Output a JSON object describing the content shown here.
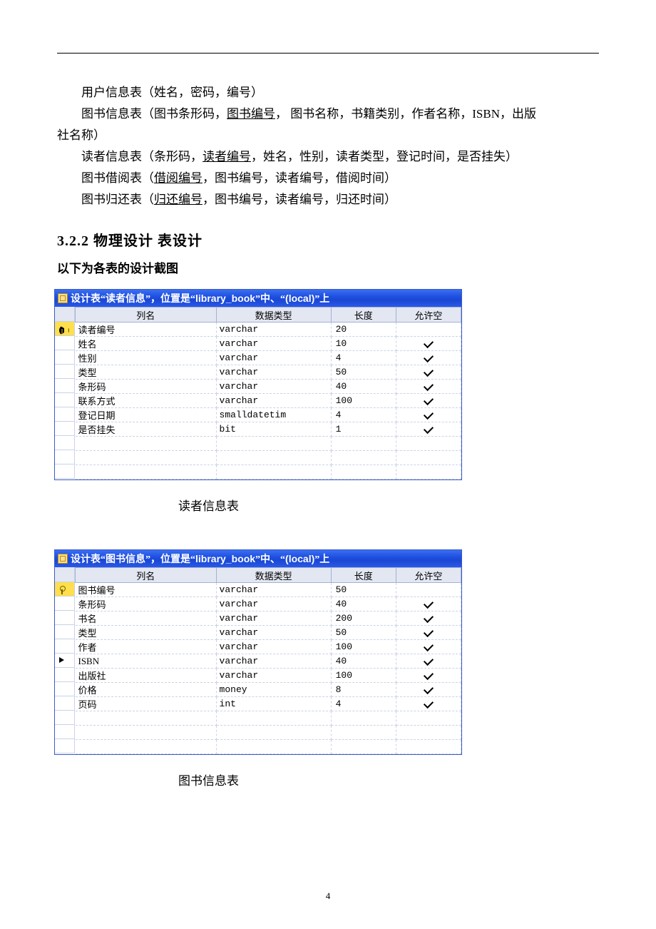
{
  "text": {
    "line1": "用户信息表（姓名，密码，编号）",
    "line2a": "图书信息表（图书条形码，",
    "line2u": "图书编号",
    "line2b": "， 图书名称，书籍类别，作者名称，ISBN，出版",
    "line2c": "社名称）",
    "line3a": "读者信息表（条形码，",
    "line3u": "读者编号",
    "line3b": "，姓名，性别，读者类型，登记时间，是否挂失）",
    "line4a": "图书借阅表（",
    "line4u": "借阅编号",
    "line4b": "，图书编号，读者编号，借阅时间）",
    "line5a": "图书归还表（",
    "line5u": "归还编号",
    "line5b": "，图书编号，读者编号，归还时间）"
  },
  "heading": "3.2.2 物理设计 表设计",
  "subtext": "以下为各表的设计截图",
  "tables": [
    {
      "title_parts": [
        "设计表",
        "“",
        "读者信息",
        "”",
        "，位置是",
        "“",
        "library_book",
        "”",
        "中、",
        "“",
        "(local)",
        "”",
        "上"
      ],
      "caption": "读者信息表",
      "headers": [
        "列名",
        "数据类型",
        "长度",
        "允许空"
      ],
      "rows": [
        {
          "name": "读者编号",
          "type": "varchar",
          "len": "20",
          "null": false,
          "pk": true,
          "cur": true
        },
        {
          "name": "姓名",
          "type": "varchar",
          "len": "10",
          "null": true,
          "pk": false,
          "cur": false
        },
        {
          "name": "性别",
          "type": "varchar",
          "len": "4",
          "null": true,
          "pk": false,
          "cur": false
        },
        {
          "name": "类型",
          "type": "varchar",
          "len": "50",
          "null": true,
          "pk": false,
          "cur": false
        },
        {
          "name": "条形码",
          "type": "varchar",
          "len": "40",
          "null": true,
          "pk": false,
          "cur": false
        },
        {
          "name": "联系方式",
          "type": "varchar",
          "len": "100",
          "null": true,
          "pk": false,
          "cur": false
        },
        {
          "name": "登记日期",
          "type": "smalldatetim",
          "len": "4",
          "null": true,
          "pk": false,
          "cur": false
        },
        {
          "name": "是否挂失",
          "type": "bit",
          "len": "1",
          "null": true,
          "pk": false,
          "cur": false
        }
      ],
      "blank_rows": 3
    },
    {
      "title_parts": [
        "设计表",
        "“",
        "图书信息",
        "”",
        "，位置是",
        "“",
        "library_book",
        "”",
        "中、",
        "“",
        "(local)",
        "”",
        "上"
      ],
      "caption": "图书信息表",
      "headers": [
        "列名",
        "数据类型",
        "长度",
        "允许空"
      ],
      "rows": [
        {
          "name": "图书编号",
          "type": "varchar",
          "len": "50",
          "null": false,
          "pk": true,
          "cur": false
        },
        {
          "name": "条形码",
          "type": "varchar",
          "len": "40",
          "null": true,
          "pk": false,
          "cur": false
        },
        {
          "name": "书名",
          "type": "varchar",
          "len": "200",
          "null": true,
          "pk": false,
          "cur": false
        },
        {
          "name": "类型",
          "type": "varchar",
          "len": "50",
          "null": true,
          "pk": false,
          "cur": false
        },
        {
          "name": "作者",
          "type": "varchar",
          "len": "100",
          "null": true,
          "pk": false,
          "cur": false
        },
        {
          "name": "ISBN",
          "type": "varchar",
          "len": "40",
          "null": true,
          "pk": false,
          "cur": true
        },
        {
          "name": "出版社",
          "type": "varchar",
          "len": "100",
          "null": true,
          "pk": false,
          "cur": false
        },
        {
          "name": "价格",
          "type": "money",
          "len": "8",
          "null": true,
          "pk": false,
          "cur": false
        },
        {
          "name": "页码",
          "type": "int",
          "len": "4",
          "null": true,
          "pk": false,
          "cur": false
        }
      ],
      "blank_rows": 3
    }
  ],
  "pagenum": "4"
}
